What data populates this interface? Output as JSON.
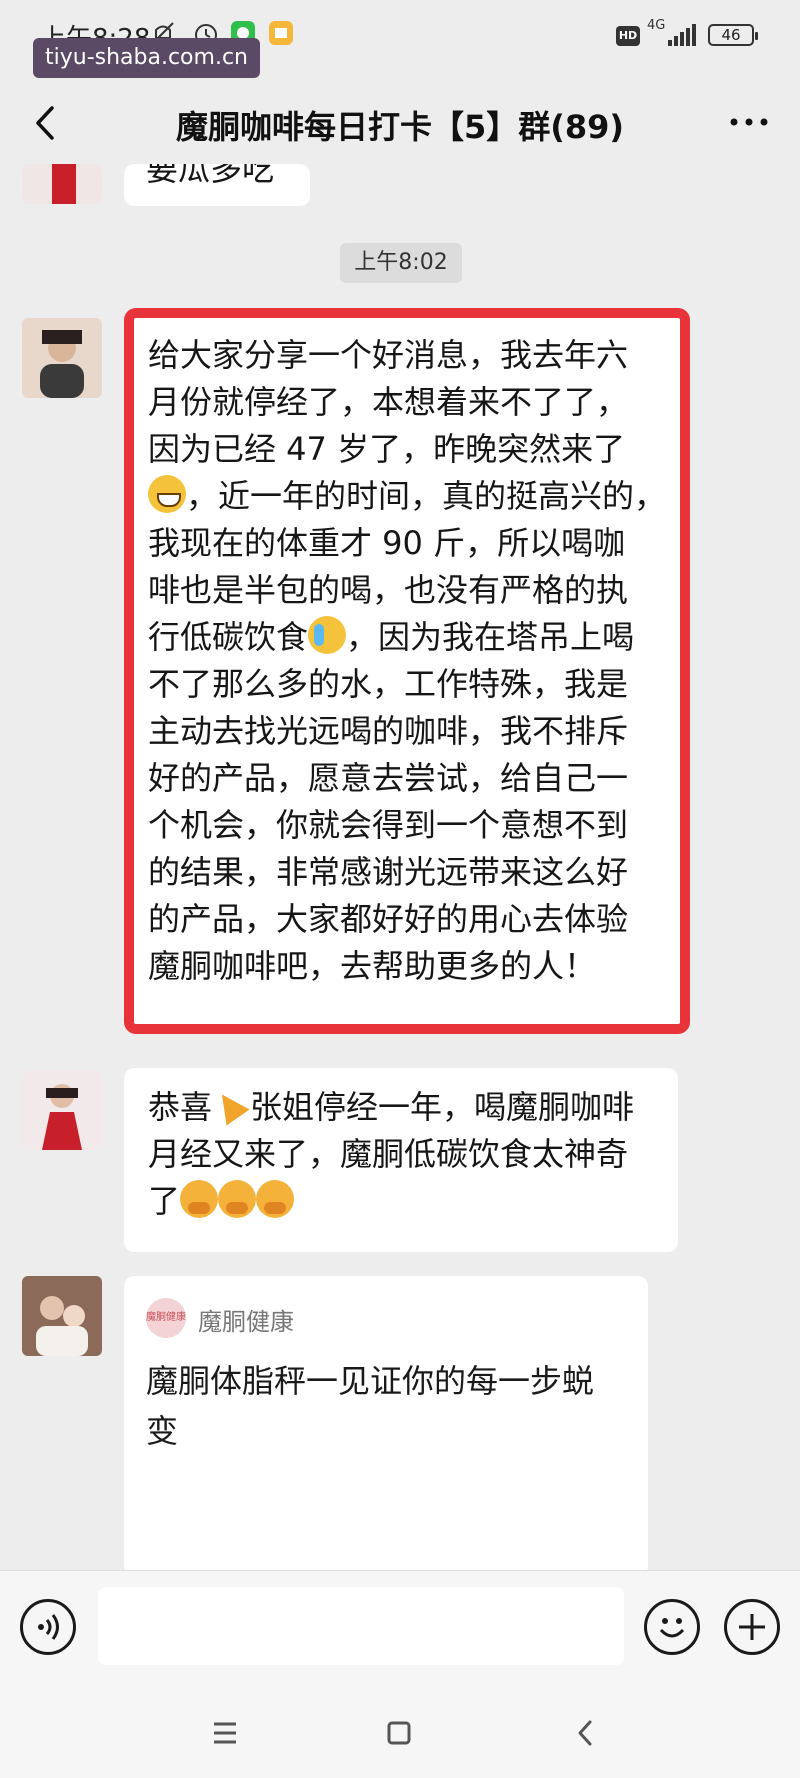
{
  "status_bar": {
    "time": "上午8:28",
    "network": "4G",
    "battery": "46",
    "watermark": "tiyu-shaba.com.cn"
  },
  "header": {
    "title": "魔胴咖啡每日打卡【5】群(89)"
  },
  "chat": {
    "partial_message": "要瓜多吃",
    "timestamp": "上午8:02",
    "messages": [
      {
        "lines": [
          "给大家分享一个好消息，我去年六",
          "月份就停经了，本想着来不了了，",
          "因为已经 47 岁了，昨晚突然来了",
          "，近一年的时间，真的挺高兴的，",
          "我现在的体重才 90 斤，所以喝咖",
          "啡也是半包的喝，也没有严格的执",
          "行低碳饮食",
          "，因为我在塔吊上喝",
          "不了那么多的水，工作特殊，我是",
          "主动去找光远喝的咖啡，我不排斥",
          "好的产品，愿意去尝试，给自己一",
          "个机会，你就会得到一个意想不到",
          "的结果，非常感谢光远带来这么好",
          "的产品，大家都好好的用心去体验",
          "魔胴咖啡吧，去帮助更多的人！"
        ]
      },
      {
        "line1a": "恭喜",
        "line1b": "张姐停经一年，喝魔胴咖啡",
        "line2": "月经又来了，魔胴低碳饮食太神奇",
        "line3": "了"
      }
    ],
    "link_card": {
      "source": "魔胴健康",
      "logo_text": "魔胴健康",
      "title_line1": "魔胴体脂秤一见证你的每一步蜕",
      "title_line2": "变"
    }
  },
  "input": {
    "placeholder": ""
  },
  "colors": {
    "highlight_border": "#e8333a",
    "background": "#ededed"
  }
}
